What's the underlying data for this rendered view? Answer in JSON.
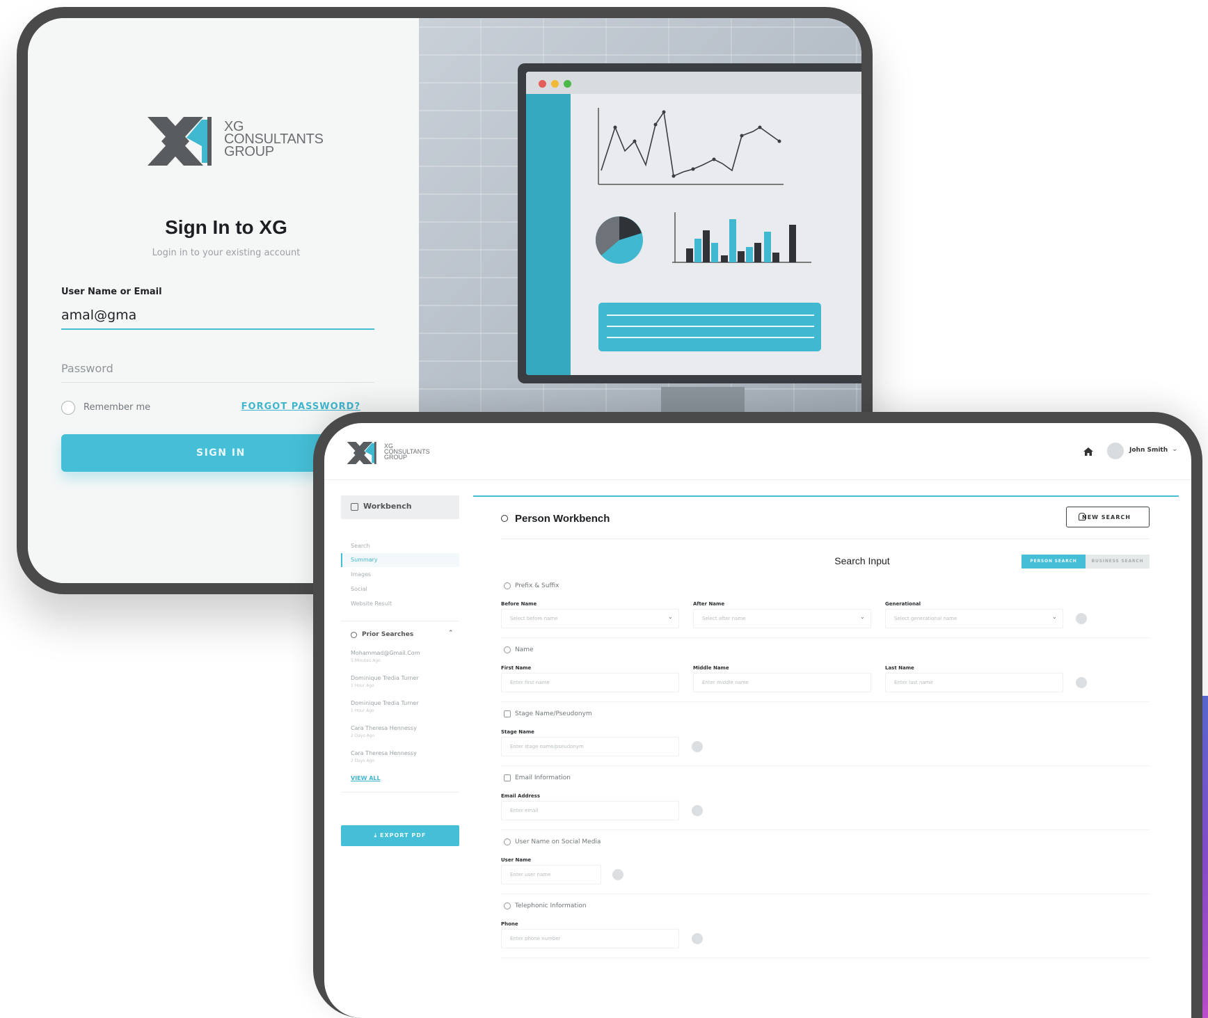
{
  "login": {
    "logo": {
      "line1": "XG",
      "line2": "CONSULTANTS",
      "line3": "GROUP"
    },
    "title": "Sign In to XG",
    "subtitle": "Login in to your existing account",
    "username_label": "User Name or Email",
    "username_value": "amal@gma",
    "password_placeholder": "Password",
    "remember_label": "Remember me",
    "forgot_label": "FORGOT PASSWORD?",
    "signin_label": "SIGN IN"
  },
  "workbench": {
    "logo": {
      "line1": "XG",
      "line2": "CONSULTANTS",
      "line3": "GROUP"
    },
    "user_name": "John Smith",
    "sidebar": {
      "workbench_label": "Workbench",
      "items": [
        {
          "label": "Search"
        },
        {
          "label": "Summary"
        },
        {
          "label": "Images"
        },
        {
          "label": "Social"
        },
        {
          "label": "Website Result"
        }
      ],
      "prior_label": "Prior Searches",
      "prior_items": [
        {
          "name": "Mohammad@Gmail.Com",
          "time": "5 Minutes Ago"
        },
        {
          "name": "Dominique Tredia Turner",
          "time": "1 Hour Ago"
        },
        {
          "name": "Dominique Tredia Turner",
          "time": "1 Hour Ago"
        },
        {
          "name": "Cara Theresa Hennessy",
          "time": "2 Days Ago"
        },
        {
          "name": "Cara Theresa Hennessy",
          "time": "2 Days Ago"
        }
      ],
      "view_all": "VIEW ALL",
      "export_label": "EXPORT PDF"
    },
    "main": {
      "title": "Person Workbench",
      "new_search": "NEW SEARCH",
      "search_input_title": "Search Input",
      "seg_person": "PERSON SEARCH",
      "seg_business": "BUSINESS SEARCH",
      "sections": {
        "prefix": {
          "title": "Prefix & Suffix",
          "before_label": "Before Name",
          "before_placeholder": "Select before name",
          "after_label": "After Name",
          "after_placeholder": "Select after name",
          "gen_label": "Generational",
          "gen_placeholder": "Select generational name"
        },
        "name": {
          "title": "Name",
          "first_label": "First Name",
          "first_placeholder": "Enter first name",
          "middle_label": "Middle Name",
          "middle_placeholder": "Enter middle name",
          "last_label": "Last Name",
          "last_placeholder": "Enter last name"
        },
        "stage": {
          "title": "Stage Name/Pseudonym",
          "label": "Stage Name",
          "placeholder": "Enter stage name/pseudonym"
        },
        "email": {
          "title": "Email Information",
          "label": "Email Address",
          "placeholder": "Enter email"
        },
        "social": {
          "title": "User Name on Social Media",
          "label": "User Name",
          "placeholder": "Enter user name"
        },
        "phone": {
          "title": "Telephonic Information",
          "label": "Phone",
          "placeholder": "Enter phone number"
        }
      }
    }
  }
}
